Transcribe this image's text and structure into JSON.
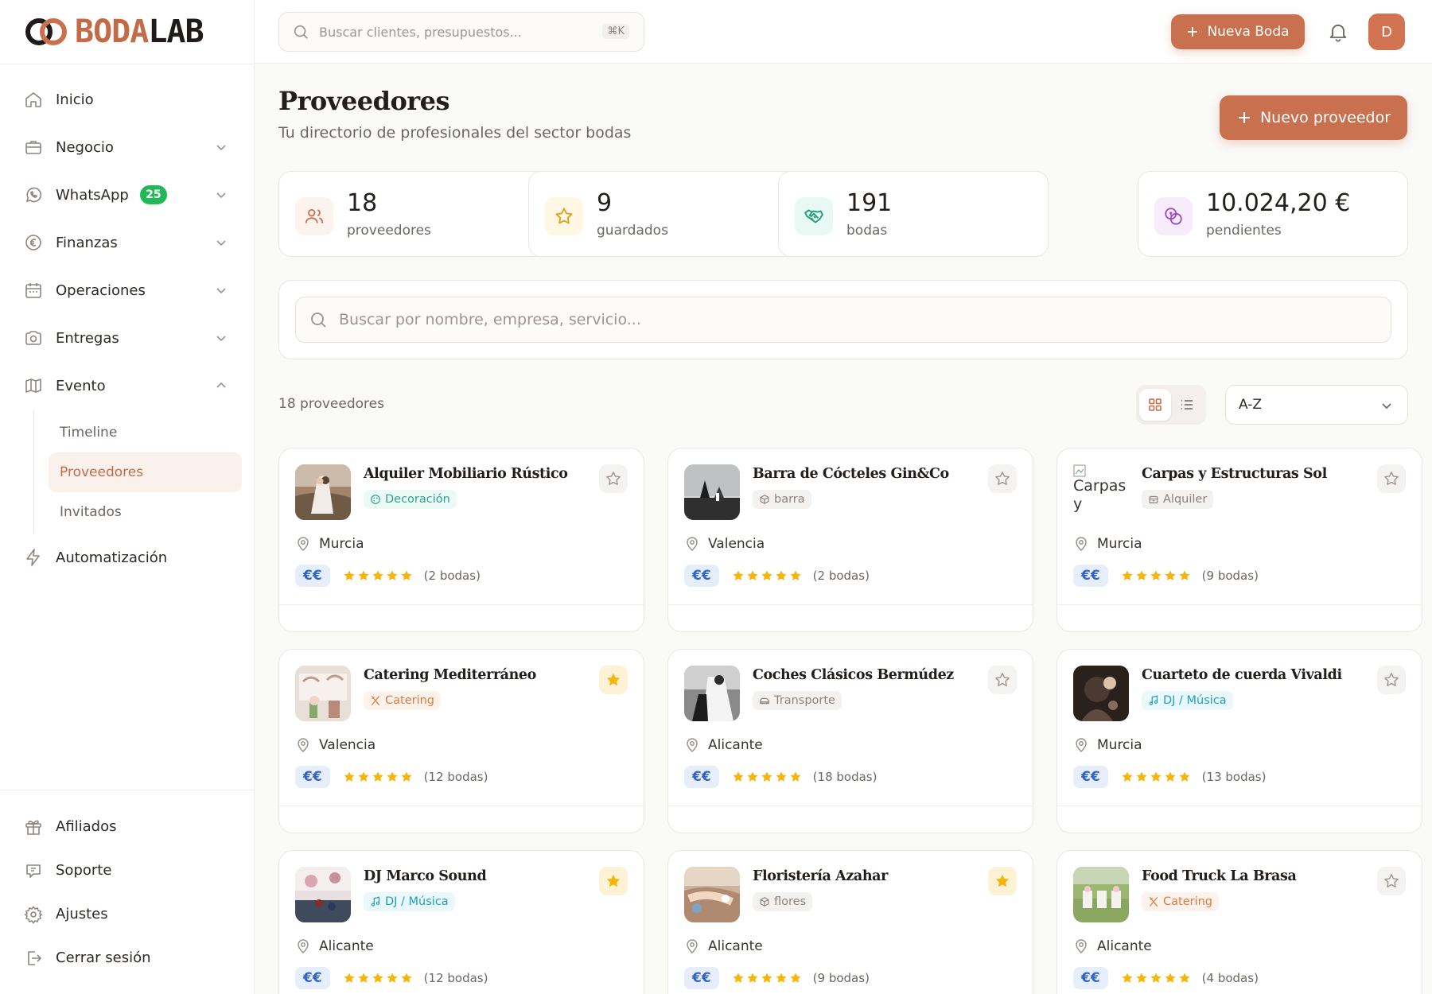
{
  "brand": {
    "logo_part1": "BODA",
    "logo_part2": "LAB",
    "accent": "#c9714f"
  },
  "topbar": {
    "search_placeholder": "Buscar clientes, presupuestos...",
    "shortcut": "⌘K",
    "new_wedding_label": "Nueva Boda",
    "avatar_initial": "D"
  },
  "sidebar": {
    "items": [
      {
        "label": "Inicio",
        "icon": "home-icon",
        "expandable": false
      },
      {
        "label": "Negocio",
        "icon": "briefcase-icon",
        "expandable": true
      },
      {
        "label": "WhatsApp",
        "icon": "whatsapp-icon",
        "expandable": true,
        "badge": "25"
      },
      {
        "label": "Finanzas",
        "icon": "euro-icon",
        "expandable": true
      },
      {
        "label": "Operaciones",
        "icon": "calendar-icon",
        "expandable": true
      },
      {
        "label": "Entregas",
        "icon": "camera-icon",
        "expandable": true
      },
      {
        "label": "Evento",
        "icon": "map-icon",
        "expandable": true,
        "expanded": true
      }
    ],
    "evento_sub": [
      {
        "label": "Timeline",
        "active": false
      },
      {
        "label": "Proveedores",
        "active": true
      },
      {
        "label": "Invitados",
        "active": false
      }
    ],
    "automatizacion": "Automatización",
    "bottom": [
      {
        "label": "Afiliados",
        "icon": "gift-icon"
      },
      {
        "label": "Soporte",
        "icon": "support-chat-icon"
      },
      {
        "label": "Ajustes",
        "icon": "settings-icon"
      },
      {
        "label": "Cerrar sesión",
        "icon": "logout-icon"
      }
    ]
  },
  "page": {
    "title": "Proveedores",
    "subtitle": "Tu directorio de profesionales del sector bodas",
    "new_provider_label": "Nuevo proveedor"
  },
  "stats": [
    {
      "value": "18",
      "label": "proveedores",
      "icon": "users-icon",
      "color": "#c9714f",
      "bg": "#fdf3ee"
    },
    {
      "value": "9",
      "label": "guardados",
      "icon": "star-icon",
      "color": "#e0a21d",
      "bg": "#fef7e4"
    },
    {
      "value": "191",
      "label": "bodas",
      "icon": "handshake-icon",
      "color": "#1f9a78",
      "bg": "#e8f8f2"
    },
    {
      "value": "10.024,20 €",
      "label": "pendientes",
      "icon": "coins-icon",
      "color": "#9b45c9",
      "bg": "#f6ecfc"
    }
  ],
  "filters": {
    "search_placeholder": "Buscar por nombre, empresa, servicio...",
    "count_text": "18 proveedores",
    "sort_value": "A-Z"
  },
  "providers": [
    {
      "name": "Alquiler Mobiliario Rústico",
      "category": "Decoración",
      "cat_style": "deco",
      "cat_icon": "palette-icon",
      "location": "Murcia",
      "price": "€€",
      "rating": 5,
      "weddings": "(2 bodas)",
      "favorite": false,
      "thumb": "couple-photo"
    },
    {
      "name": "Barra de Cócteles Gin&Co",
      "category": "barra",
      "cat_style": "grey",
      "cat_icon": "package-icon",
      "location": "Valencia",
      "price": "€€",
      "rating": 5,
      "weddings": "(2 bodas)",
      "favorite": false,
      "thumb": "beach-photo"
    },
    {
      "name": "Carpas y Estructuras Sol",
      "category": "Alquiler",
      "cat_style": "grey",
      "cat_icon": "box-icon",
      "location": "Murcia",
      "price": "€€",
      "rating": 5,
      "weddings": "(9 bodas)",
      "favorite": false,
      "thumb": "broken-image",
      "thumb_alt": "Carpas y"
    },
    {
      "name": "Catering Mediterráneo",
      "category": "Catering",
      "cat_style": "cater",
      "cat_icon": "utensils-icon",
      "location": "Valencia",
      "price": "€€",
      "rating": 5,
      "weddings": "(12 bodas)",
      "favorite": true,
      "thumb": "venue-photo"
    },
    {
      "name": "Coches Clásicos Bermúdez",
      "category": "Transporte",
      "cat_style": "grey",
      "cat_icon": "car-icon",
      "location": "Alicante",
      "price": "€€",
      "rating": 5,
      "weddings": "(18 bodas)",
      "favorite": false,
      "thumb": "bw-couple-photo"
    },
    {
      "name": "Cuarteto de cuerda Vivaldi",
      "category": "DJ / Música",
      "cat_style": "dj",
      "cat_icon": "music-icon",
      "location": "Murcia",
      "price": "€€",
      "rating": 5,
      "weddings": "(13 bodas)",
      "favorite": false,
      "thumb": "dark-photo"
    },
    {
      "name": "DJ Marco Sound",
      "category": "DJ / Música",
      "cat_style": "dj",
      "cat_icon": "music-icon",
      "location": "Alicante",
      "price": "€€",
      "rating": 5,
      "weddings": "(12 bodas)",
      "favorite": true,
      "thumb": "party-photo"
    },
    {
      "name": "Floristería Azahar",
      "category": "flores",
      "cat_style": "grey",
      "cat_icon": "package-icon",
      "location": "Alicante",
      "price": "€€",
      "rating": 5,
      "weddings": "(9 bodas)",
      "favorite": true,
      "thumb": "hands-photo"
    },
    {
      "name": "Food Truck La Brasa",
      "category": "Catering",
      "cat_style": "cater",
      "cat_icon": "utensils-icon",
      "location": "Alicante",
      "price": "€€",
      "rating": 5,
      "weddings": "(4 bodas)",
      "favorite": false,
      "thumb": "garden-photo"
    }
  ],
  "colors": {
    "star": "#f5b50a",
    "price_bg": "#e6eefb",
    "price_text": "#3064c9"
  }
}
